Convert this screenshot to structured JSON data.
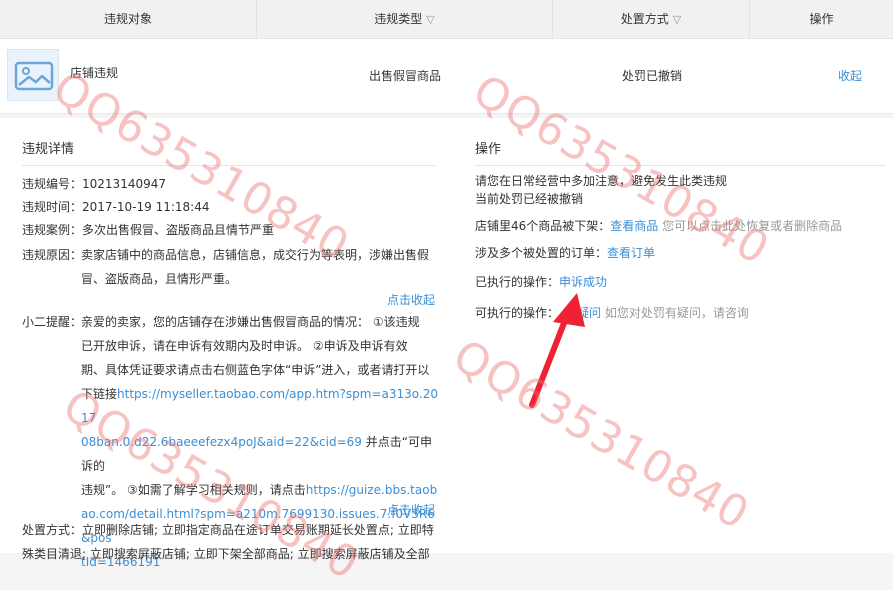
{
  "table": {
    "headers": [
      "违规对象",
      "违规类型",
      "处置方式",
      "操作"
    ],
    "row": {
      "object": "店铺违规",
      "type": "出售假冒商品",
      "handling": "处罚已撤销",
      "action": "收起"
    }
  },
  "details": {
    "title": "违规详情",
    "id_label": "违规编号：",
    "id_value": "10213140947",
    "time_label": "违规时间：",
    "time_value": "2017-10-19 11:18:44",
    "case_label": "违规案例：",
    "case_value": "多次出售假冒、盗版商品且情节严重",
    "reason_label": "违规原因：",
    "reason_line1": "卖家店铺中的商品信息，店铺信息，成交行为等表明，涉嫌出售假",
    "reason_line2": "冒、盗版商品，且情形严重。",
    "collapse1": "点击收起",
    "tip_label": "小二提醒：",
    "tip_line1": "亲爱的卖家，您的店铺存在涉嫌出售假冒商品的情况： ①该违规",
    "tip_line2": "已开放申诉，请在申诉有效期内及时申诉。 ②申诉及申诉有效",
    "tip_line3": "期、具体凭证要求请点击右侧蓝色字体“申诉”进入，或者请打开以",
    "tip_line4a": "下链接",
    "tip_link1a": "https://myseller.taobao.com/app.htm?spm=a313o.2017",
    "tip_link1b": "08ban.0.d22.6baeeefezx4poJ&aid=22&cid=69",
    "tip_line5b": " 并点击“可申诉的",
    "tip_line6a": "违规”。 ③如需了解学习相关规则，请点击",
    "tip_link2a": "https://guize.bbs.taob",
    "tip_link2b": "ao.com/detail.html?spm=a210m.7699130.issues.7.f0V3R6&pos",
    "tip_link2c": "tId=1466191",
    "collapse2": "点击收起",
    "handle_label": "处置方式：",
    "handle_line1": "立即删除店铺; 立即指定商品在途订单交易账期延长处置点; 立即特",
    "handle_line2": "殊类目清退; 立即搜索屏蔽店铺; 立即下架全部商品; 立即搜索屏蔽店铺及全部"
  },
  "ops": {
    "title": "操作",
    "notice1": "请您在日常经营中多加注意，避免发生此类违规",
    "notice2": "当前处罚已经被撤销",
    "removed_text": "店铺里46个商品被下架：",
    "removed_link": "查看商品",
    "removed_hint": "您可以点击此处恢复或者删除商品",
    "orders_text": "涉及多个被处置的订单：",
    "orders_link": "查看订单",
    "executed_text": "已执行的操作：",
    "executed_link": "申诉成功",
    "available_text": "可执行的操作：",
    "available_link": "疑问",
    "available_hint": "如您对处罚有疑问，请咨询"
  },
  "watermark": "QQ635310840",
  "colors": {
    "link": "#3a8fd6",
    "arrow": "#ee2233",
    "watermark": "#eb6e6e"
  }
}
